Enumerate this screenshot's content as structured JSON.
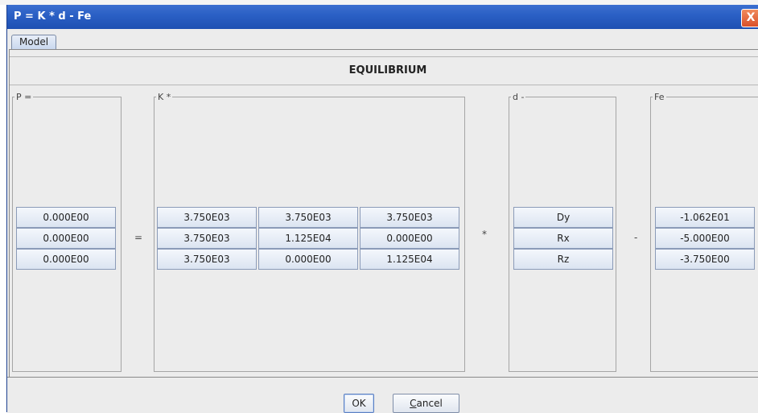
{
  "window": {
    "title": "P = K * d - Fe",
    "close_glyph": "X"
  },
  "tabs": [
    {
      "label": "Model"
    }
  ],
  "heading": "EQUILIBRIUM",
  "groups": {
    "p": "P =",
    "k": "K *",
    "d": "d -",
    "fe": "Fe"
  },
  "operators": {
    "equals": "=",
    "times": "*",
    "minus": "-"
  },
  "p_values": [
    "0.000E00",
    "0.000E00",
    "0.000E00"
  ],
  "k_matrix": [
    [
      "3.750E03",
      "3.750E03",
      "3.750E03"
    ],
    [
      "3.750E03",
      "1.125E04",
      "0.000E00"
    ],
    [
      "3.750E03",
      "0.000E00",
      "1.125E04"
    ]
  ],
  "d_values": [
    "Dy",
    "Rx",
    "Rz"
  ],
  "fe_values": [
    "-1.062E01",
    "-5.000E00",
    "-3.750E00"
  ],
  "buttons": {
    "ok": "OK",
    "cancel_mnemonic": "C",
    "cancel_rest": "ancel"
  }
}
